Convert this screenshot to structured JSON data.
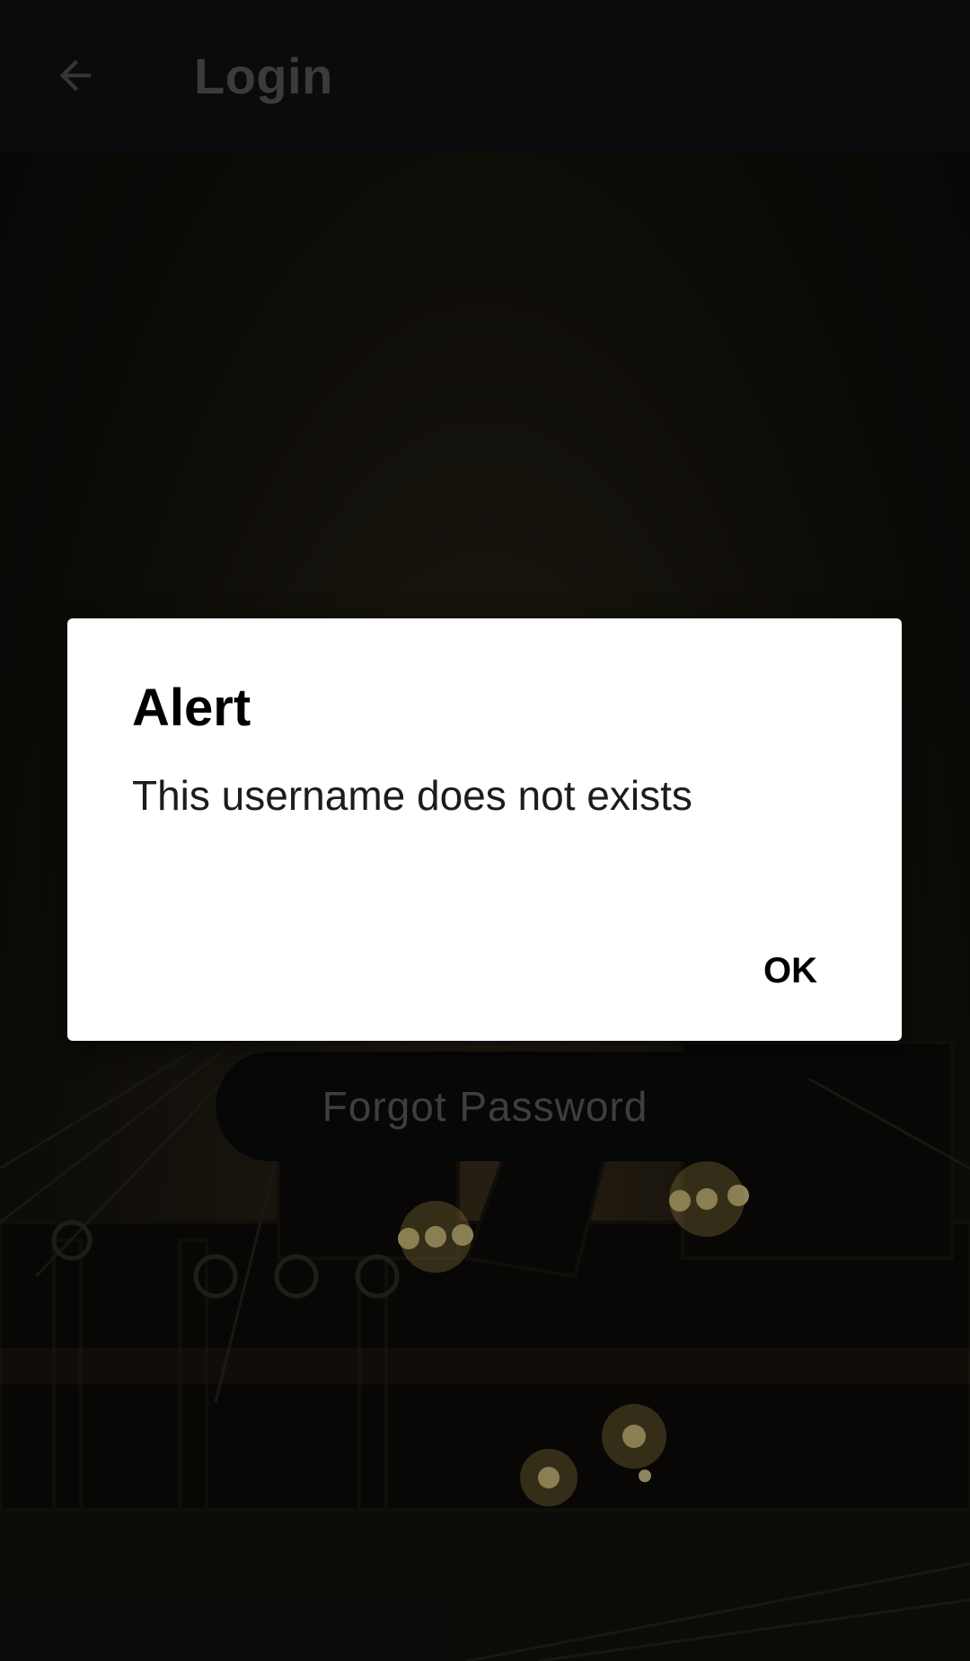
{
  "app_bar": {
    "title": "Login",
    "back_icon": "arrow-back-icon"
  },
  "login": {
    "forgot_password_label": "Forgot Password"
  },
  "dialog": {
    "title": "Alert",
    "message": "This username does not exists",
    "ok_label": "OK"
  },
  "colors": {
    "app_bar_bg": "#121416",
    "dialog_bg": "#ffffff",
    "muted_text": "#6a6c6e"
  }
}
